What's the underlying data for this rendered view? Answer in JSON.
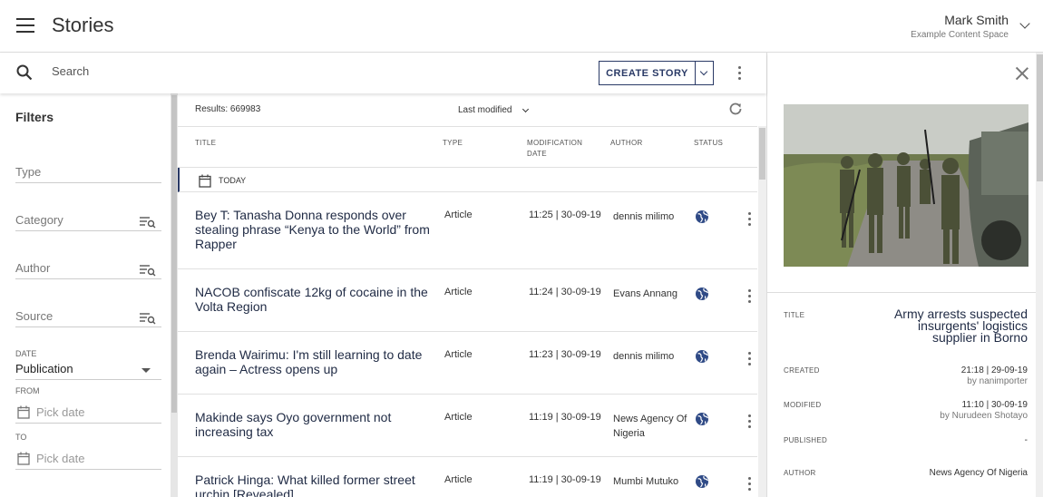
{
  "header": {
    "title": "Stories",
    "user_name": "Mark Smith",
    "user_space": "Example Content Space"
  },
  "search": {
    "placeholder": "Search",
    "create_label": "CREATE STORY"
  },
  "filters": {
    "title": "Filters",
    "type_label": "Type",
    "category_label": "Category",
    "author_label": "Author",
    "source_label": "Source",
    "date_label": "DATE",
    "date_value": "Publication",
    "from_label": "FROM",
    "to_label": "TO",
    "from_placeholder": "Pick date",
    "to_placeholder": "Pick date"
  },
  "results": {
    "count": "Results: 669983",
    "sort_label": "Last modified",
    "columns": {
      "title": "TITLE",
      "type": "TYPE",
      "modification_date": "MODIFICATION DATE",
      "author": "AUTHOR",
      "status": "STATUS"
    },
    "group_label": "TODAY",
    "rows": [
      {
        "title": "Bey T: Tanasha Donna responds over stealing phrase “Kenya to the World” from Rapper",
        "type": "Article",
        "date": "11:25 | 30-09-19",
        "author": "dennis milimo"
      },
      {
        "title": "NACOB confiscate 12kg of cocaine in the Volta Region",
        "type": "Article",
        "date": "11:24 | 30-09-19",
        "author": "Evans Annang"
      },
      {
        "title": "Brenda Wairimu: I'm still learning to date again – Actress opens up",
        "type": "Article",
        "date": "11:23 | 30-09-19",
        "author": "dennis milimo"
      },
      {
        "title": "Makinde says Oyo government not increasing tax",
        "type": "Article",
        "date": "11:19 | 30-09-19",
        "author": "News Agency Of Nigeria"
      },
      {
        "title": "Patrick Hinga: What killed former street urchin [Revealed]",
        "type": "Article",
        "date": "11:19 | 30-09-19",
        "author": "Mumbi Mutuko"
      }
    ]
  },
  "detail": {
    "title_label": "TITLE",
    "title_value": "Army arrests suspected insurgents' logistics supplier in Borno",
    "created_label": "CREATED",
    "created_value": "21:18 | 29-09-19",
    "created_by": "by nanimporter",
    "modified_label": "MODIFIED",
    "modified_value": "11:10 | 30-09-19",
    "modified_by": "by Nurudeen Shotayo",
    "published_label": "PUBLISHED",
    "published_value": "-",
    "author_label": "AUTHOR",
    "author_value": "News Agency Of Nigeria"
  },
  "colors": {
    "accent": "#2a3a66",
    "status_icon": "#2f4a86"
  },
  "icons": [
    "menu-icon",
    "search-icon",
    "chevron-down-icon",
    "more-vert-icon",
    "filter-list-icon",
    "calendar-icon",
    "refresh-icon",
    "globe-icon",
    "close-icon"
  ]
}
